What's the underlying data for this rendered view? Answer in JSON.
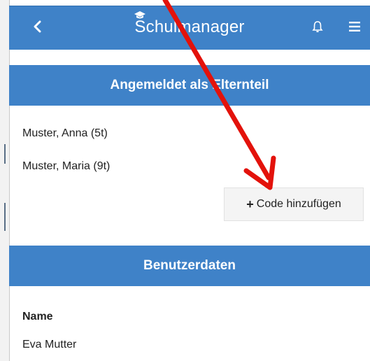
{
  "app": {
    "title": "Schulmanager"
  },
  "parent_section": {
    "heading": "Angemeldet als Elternteil",
    "children": [
      {
        "label": "Muster, Anna (5t)"
      },
      {
        "label": "Muster, Maria (9t)"
      }
    ],
    "add_code_label": "Code hinzufügen"
  },
  "user_section": {
    "heading": "Benutzerdaten",
    "name_label": "Name",
    "name_value": "Eva Mutter"
  },
  "icons": {
    "back": "chevron-left-icon",
    "logo": "graduation-cap-icon",
    "notifications": "bell-icon",
    "menu": "hamburger-menu-icon",
    "add": "plus-icon"
  },
  "colors": {
    "header_blue": "#3f82c8",
    "annotation_red": "#e3120b"
  }
}
